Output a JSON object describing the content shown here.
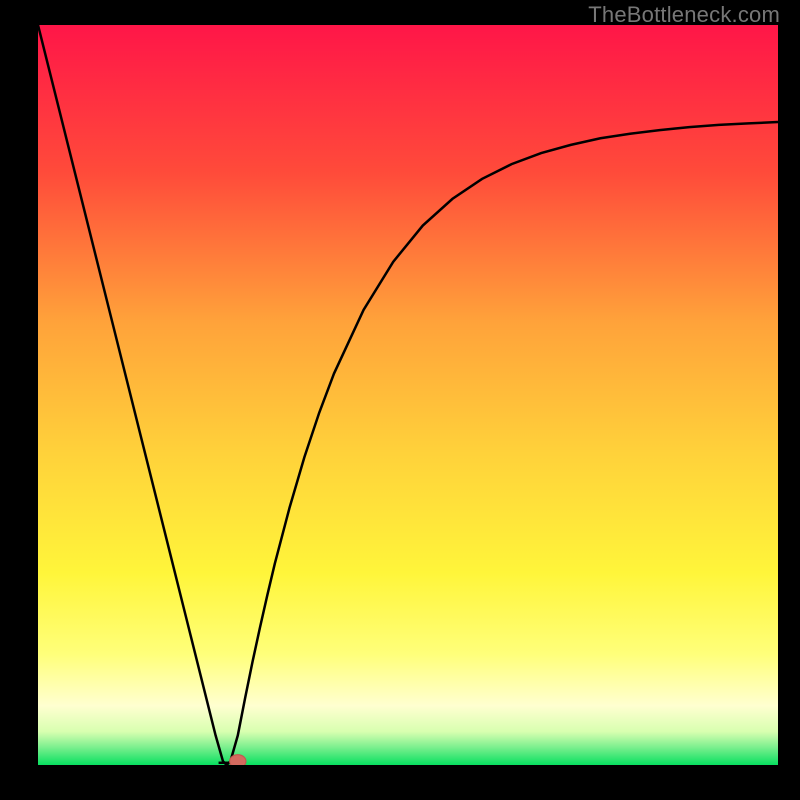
{
  "watermark": "TheBottleneck.com",
  "credit": "",
  "colors": {
    "bg": "#000000",
    "curve": "#000000",
    "dot_fill": "#d46a5f",
    "dot_stroke": "#c3584e"
  },
  "chart_data": {
    "type": "line",
    "title": "",
    "xlabel": "",
    "ylabel": "",
    "xlim": [
      0,
      100
    ],
    "ylim": [
      0,
      100
    ],
    "grid": false,
    "legend_position": "none",
    "gradient_stops": [
      {
        "offset": 0.0,
        "color": "#ff1648"
      },
      {
        "offset": 0.2,
        "color": "#ff4b3a"
      },
      {
        "offset": 0.4,
        "color": "#ffa23a"
      },
      {
        "offset": 0.58,
        "color": "#ffd23a"
      },
      {
        "offset": 0.74,
        "color": "#fff53a"
      },
      {
        "offset": 0.85,
        "color": "#ffff7a"
      },
      {
        "offset": 0.92,
        "color": "#ffffd0"
      },
      {
        "offset": 0.955,
        "color": "#d8ffb0"
      },
      {
        "offset": 0.975,
        "color": "#80f090"
      },
      {
        "offset": 1.0,
        "color": "#08e060"
      }
    ],
    "series": [
      {
        "name": "bottleneck-curve",
        "x": [
          0.0,
          2,
          4,
          6,
          8,
          10,
          12,
          14,
          16,
          18,
          20,
          22,
          24,
          25,
          25.5,
          26,
          27,
          28,
          29,
          30,
          31,
          32,
          34,
          36,
          38,
          40,
          44,
          48,
          52,
          56,
          60,
          64,
          68,
          72,
          76,
          80,
          84,
          88,
          92,
          96,
          100
        ],
        "y": [
          100,
          92,
          84,
          76,
          68,
          60,
          52,
          44,
          36,
          28,
          20,
          12,
          4,
          0.5,
          0,
          0.5,
          4,
          9.1,
          14,
          18.6,
          23,
          27.2,
          34.8,
          41.6,
          47.6,
          52.9,
          61.5,
          68,
          72.9,
          76.5,
          79.2,
          81.2,
          82.7,
          83.8,
          84.7,
          85.3,
          85.8,
          86.2,
          86.5,
          86.7,
          86.9
        ]
      }
    ],
    "marker": {
      "x": 27,
      "y": 0.5,
      "r": 1.2
    },
    "dip_flat": {
      "x0": 24.4,
      "x1": 26.2,
      "y": 0.3
    }
  }
}
